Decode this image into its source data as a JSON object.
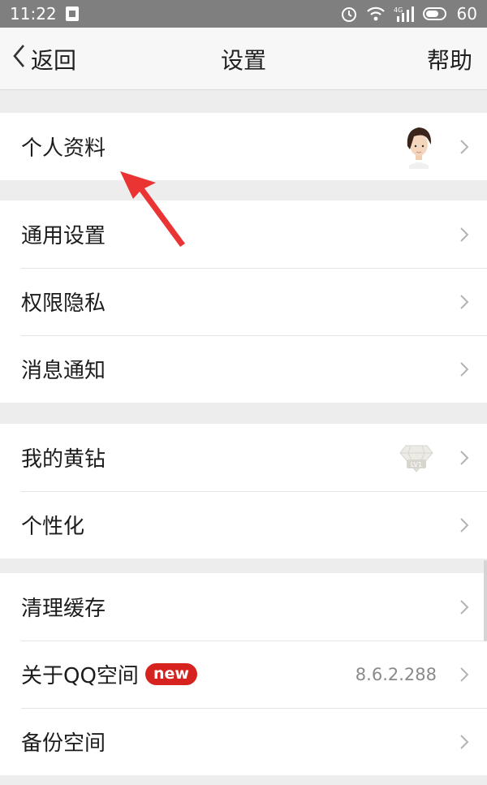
{
  "status": {
    "time": "11:22",
    "battery": "60",
    "net_type": "4G",
    "icons": [
      "sim-card-icon",
      "alarm-icon",
      "wifi-icon",
      "signal-icon",
      "battery-icon"
    ]
  },
  "nav": {
    "back_label": "返回",
    "title": "设置",
    "help_label": "帮助"
  },
  "groups": [
    {
      "items": [
        {
          "label": "个人资料",
          "accessory": "avatar"
        }
      ]
    },
    {
      "items": [
        {
          "label": "通用设置"
        },
        {
          "label": "权限隐私"
        },
        {
          "label": "消息通知"
        }
      ]
    },
    {
      "items": [
        {
          "label": "我的黄钻",
          "accessory": "yellow-diamond-lv1"
        },
        {
          "label": "个性化"
        }
      ]
    },
    {
      "items": [
        {
          "label": "清理缓存"
        },
        {
          "label": "关于QQ空间",
          "badge": "new",
          "value": "8.6.2.288"
        },
        {
          "label": "备份空间"
        }
      ]
    }
  ],
  "diamond_level_text": "LV1",
  "colors": {
    "statusbar_bg": "#7f7f7f",
    "navbar_bg": "#f7f7f7",
    "page_bg": "#ededed",
    "badge_red": "#d6231f",
    "annotation_arrow": "#ea3434",
    "chevron": "#b3b3b3"
  }
}
